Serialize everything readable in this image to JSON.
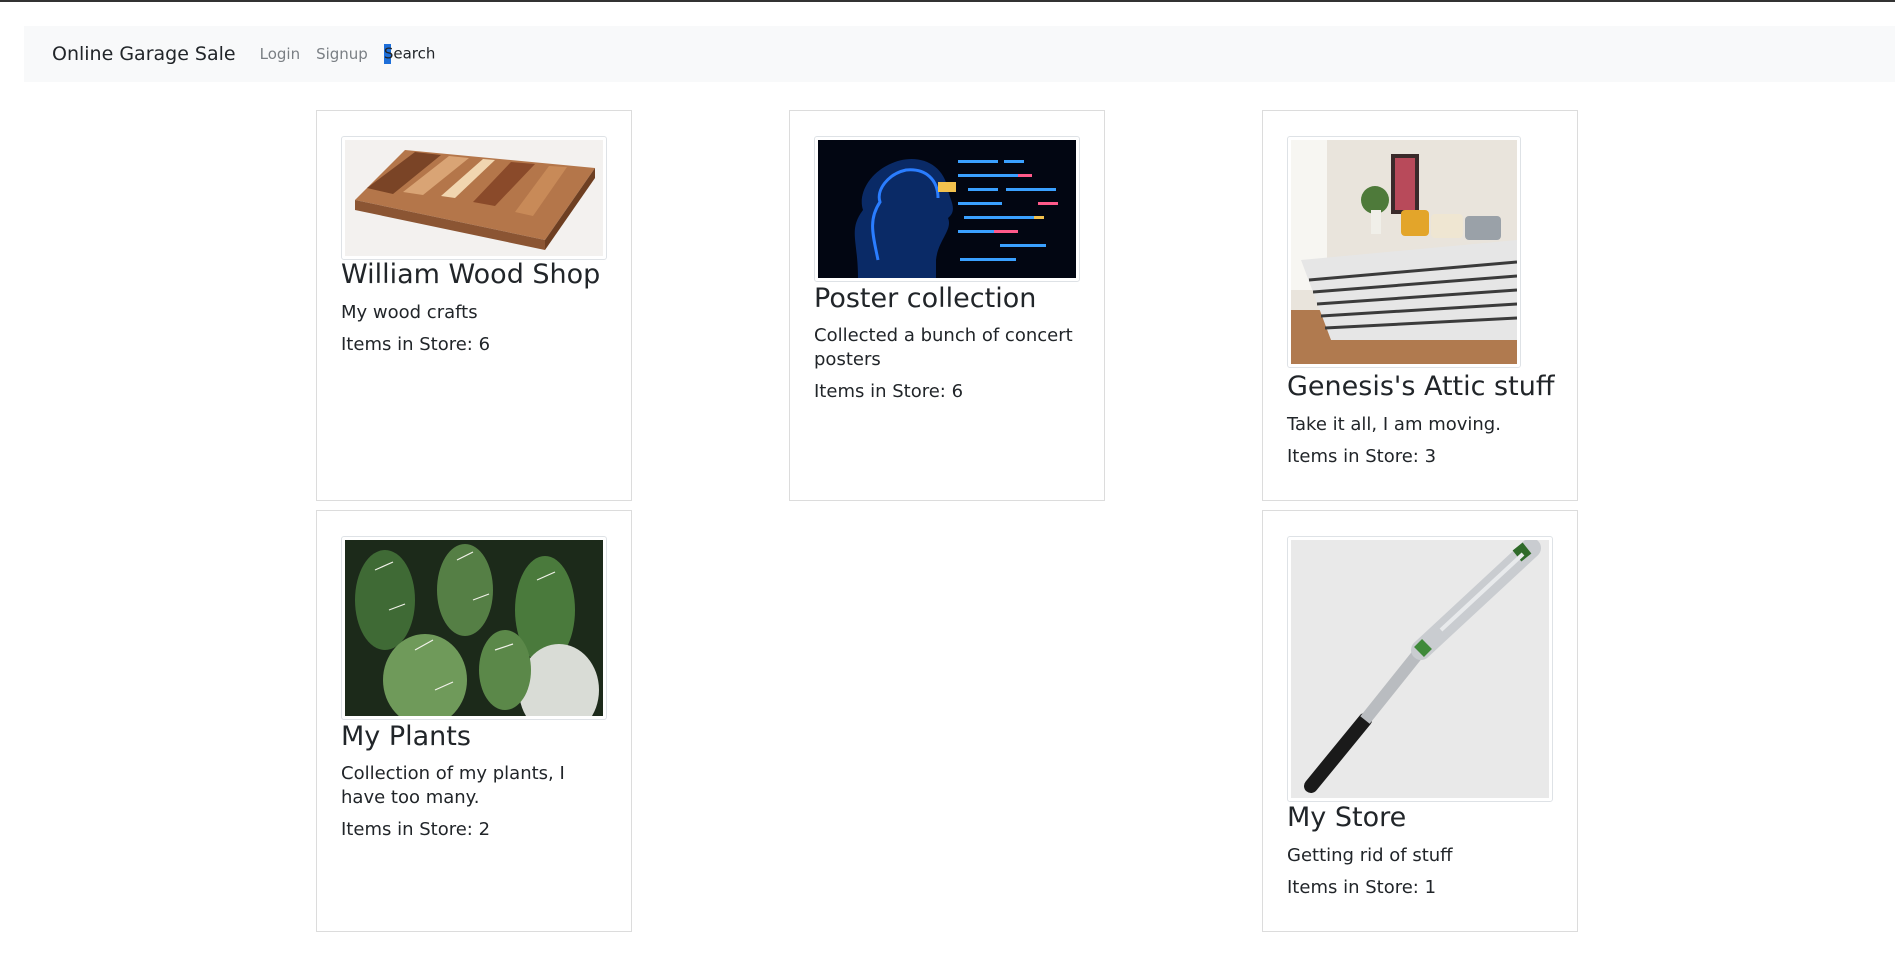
{
  "navbar": {
    "brand": "Online Garage Sale",
    "links": [
      "Login",
      "Signup",
      "Search"
    ]
  },
  "stores": [
    {
      "title": "William Wood Shop",
      "description": "My wood crafts",
      "items_label": "Items in Store: 6",
      "image": "cutting-board-image"
    },
    {
      "title": "Poster collection",
      "description": "Collected a bunch of concert posters",
      "items_label": "Items in Store: 6",
      "image": "digital-face-image"
    },
    {
      "title": "Genesis's Attic stuff",
      "description": "Take it all, I am moving.",
      "items_label": "Items in Store: 3",
      "image": "bedroom-image"
    },
    {
      "title": "My Plants",
      "description": "Collection of my plants, I have too many.",
      "items_label": "Items in Store: 2",
      "image": "cactus-image"
    },
    {
      "title": "My Store",
      "description": "Getting rid of stuff",
      "items_label": "Items in Store: 1",
      "image": "baseball-bat-image"
    }
  ]
}
